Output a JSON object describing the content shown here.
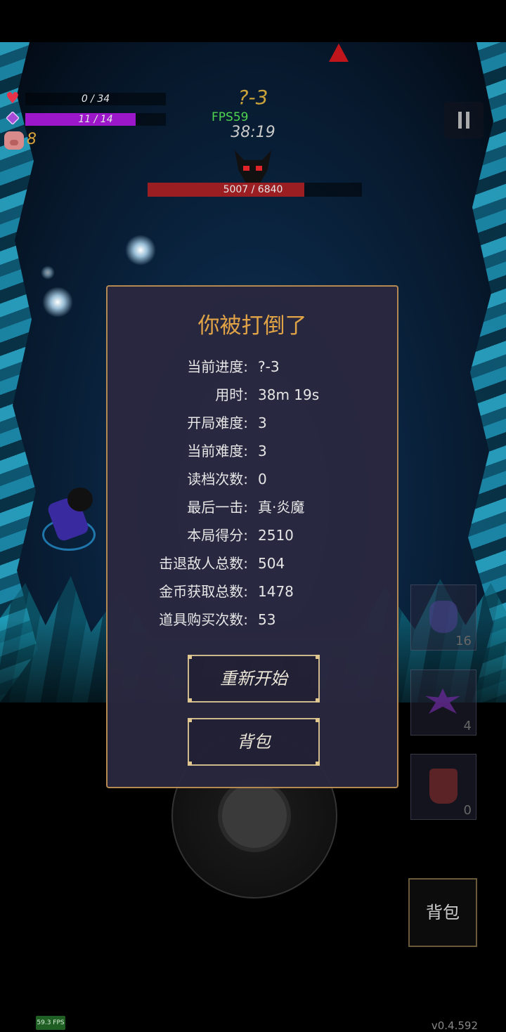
{
  "hud": {
    "hp_text": "0 / 34",
    "hp_fraction": 0.0,
    "mp_text": "11 / 14",
    "mp_fraction": 0.786,
    "coins": "8",
    "level": "?-3",
    "fps": "FPS59",
    "timer": "38:19",
    "boss_hp_text": "5007 / 6840",
    "boss_hp_fraction": 0.732,
    "pause_icon": "pause-icon"
  },
  "colors": {
    "modal_title": "#e0a345",
    "modal_border": "#b48a52",
    "mp_fill": "#9b17c9",
    "boss_fill": "#9b1e23",
    "fps_green": "#4fd44f"
  },
  "modal": {
    "title": "你被打倒了",
    "stats": [
      {
        "label": "当前进度:",
        "value": "?-3"
      },
      {
        "label": "用时:",
        "value": "38m 19s"
      },
      {
        "label": "开局难度:",
        "value": "3"
      },
      {
        "label": "当前难度:",
        "value": "3"
      },
      {
        "label": "读档次数:",
        "value": "0"
      },
      {
        "label": "最后一击:",
        "value": "真·炎魔"
      },
      {
        "label": "本局得分:",
        "value": "2510"
      },
      {
        "label": "击退敌人总数:",
        "value": "504"
      },
      {
        "label": "金币获取总数:",
        "value": "1478"
      },
      {
        "label": "道具购买次数:",
        "value": "53"
      }
    ],
    "restart_label": "重新开始",
    "bag_label": "背包"
  },
  "items": [
    {
      "icon": "potion-icon",
      "count": "16"
    },
    {
      "icon": "shuriken-icon",
      "count": "4"
    },
    {
      "icon": "red-potion-icon",
      "count": "0"
    }
  ],
  "bag_button": "背包",
  "fps_badge": "59.3 FPS",
  "version": "v0.4.592"
}
